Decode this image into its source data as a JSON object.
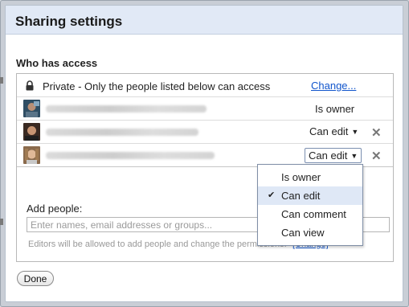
{
  "dialog": {
    "title": "Sharing settings",
    "section_label": "Who has access"
  },
  "access": {
    "private_text": "Private - Only the people listed below can access",
    "change_link": "Change..."
  },
  "people": [
    {
      "role": "Is owner"
    },
    {
      "role": "Can edit",
      "caret": "▼",
      "remove": "✕"
    },
    {
      "role": "Can edit",
      "caret": "▼",
      "remove": "✕"
    }
  ],
  "role_menu": {
    "items": [
      "Is owner",
      "Can edit",
      "Can comment",
      "Can view"
    ],
    "selected": "Can edit",
    "check": "✔"
  },
  "add_people": {
    "label": "Add people:",
    "placeholder": "Enter names, email addresses or groups...",
    "note": "Editors will be allowed to add people and change the permissions.",
    "note_link": "[Change]"
  },
  "done_label": "Done",
  "colors": {
    "title_bar": "#e1e9f6",
    "link": "#1155cc",
    "menu_highlight": "#dfe8f6"
  }
}
